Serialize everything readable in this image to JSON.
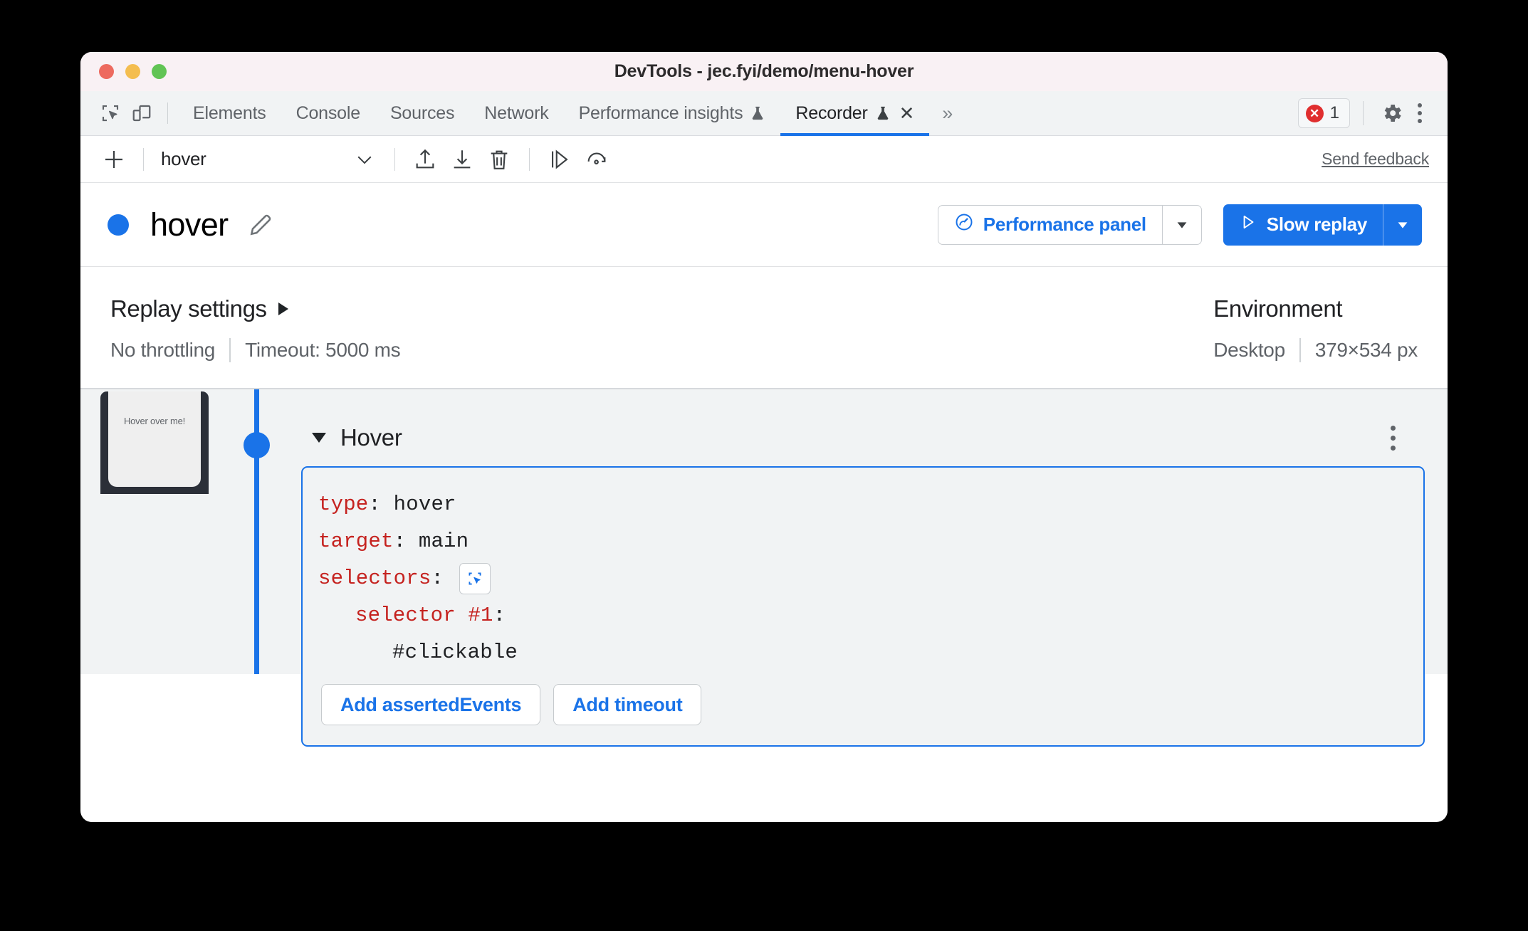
{
  "window": {
    "title": "DevTools - jec.fyi/demo/menu-hover",
    "traffic_lights": [
      "close",
      "minimize",
      "maximize"
    ]
  },
  "tabbar": {
    "left_icons": [
      "inspect-element-icon",
      "device-toolbar-icon"
    ],
    "tabs": [
      {
        "label": "Elements",
        "active": false,
        "experimental": false,
        "closable": false
      },
      {
        "label": "Console",
        "active": false,
        "experimental": false,
        "closable": false
      },
      {
        "label": "Sources",
        "active": false,
        "experimental": false,
        "closable": false
      },
      {
        "label": "Network",
        "active": false,
        "experimental": false,
        "closable": false
      },
      {
        "label": "Performance insights",
        "active": false,
        "experimental": true,
        "closable": false
      },
      {
        "label": "Recorder",
        "active": true,
        "experimental": true,
        "closable": true
      }
    ],
    "more_tabs_label": "»",
    "error_count": "1",
    "settings_icon": "gear-icon",
    "more_icon": "kebab-menu-icon"
  },
  "recorder_toolbar": {
    "add_label": "+",
    "recording_name": "hover",
    "dropdown_icon": "chevron-down-icon",
    "actions": [
      {
        "name": "export-recording",
        "icon": "upload-icon"
      },
      {
        "name": "import-recording",
        "icon": "download-icon"
      },
      {
        "name": "delete-recording",
        "icon": "trash-icon"
      },
      {
        "name": "step-over",
        "icon": "step-icon"
      },
      {
        "name": "replay",
        "icon": "replay-icon"
      }
    ],
    "feedback_label": "Send feedback"
  },
  "recording_header": {
    "title": "hover",
    "edit_icon": "pencil-icon",
    "status_color": "#1a73e8",
    "performance_button": {
      "label": "Performance panel",
      "icon": "performance-icon",
      "dropdown_icon": "chevron-down-icon"
    },
    "replay_button": {
      "label": "Slow replay",
      "icon": "play-icon",
      "dropdown_icon": "chevron-down-icon"
    }
  },
  "settings": {
    "replay_settings_label": "Replay settings",
    "expand_icon": "triangle-right-icon",
    "throttling": "No throttling",
    "timeout": "Timeout: 5000 ms",
    "environment_label": "Environment",
    "device": "Desktop",
    "viewport": "379×534 px"
  },
  "step": {
    "thumbnail_text": "Hover over me!",
    "collapse_icon": "triangle-down-icon",
    "title": "Hover",
    "menu_icon": "kebab-menu-icon",
    "code": {
      "type_key": "type",
      "type_value": "hover",
      "target_key": "target",
      "target_value": "main",
      "selectors_key": "selectors",
      "selector_picker_icon": "cursor-select-icon",
      "selector_1_key": "selector #1",
      "selector_1_value": "#clickable"
    },
    "buttons": [
      {
        "label": "Add assertedEvents"
      },
      {
        "label": "Add timeout"
      }
    ]
  },
  "colors": {
    "accent": "#1a73e8",
    "error": "#e02f2f",
    "code_key": "#c5221f",
    "panel_bg": "#f1f3f4",
    "titlebar_bg": "#f9f1f4"
  }
}
